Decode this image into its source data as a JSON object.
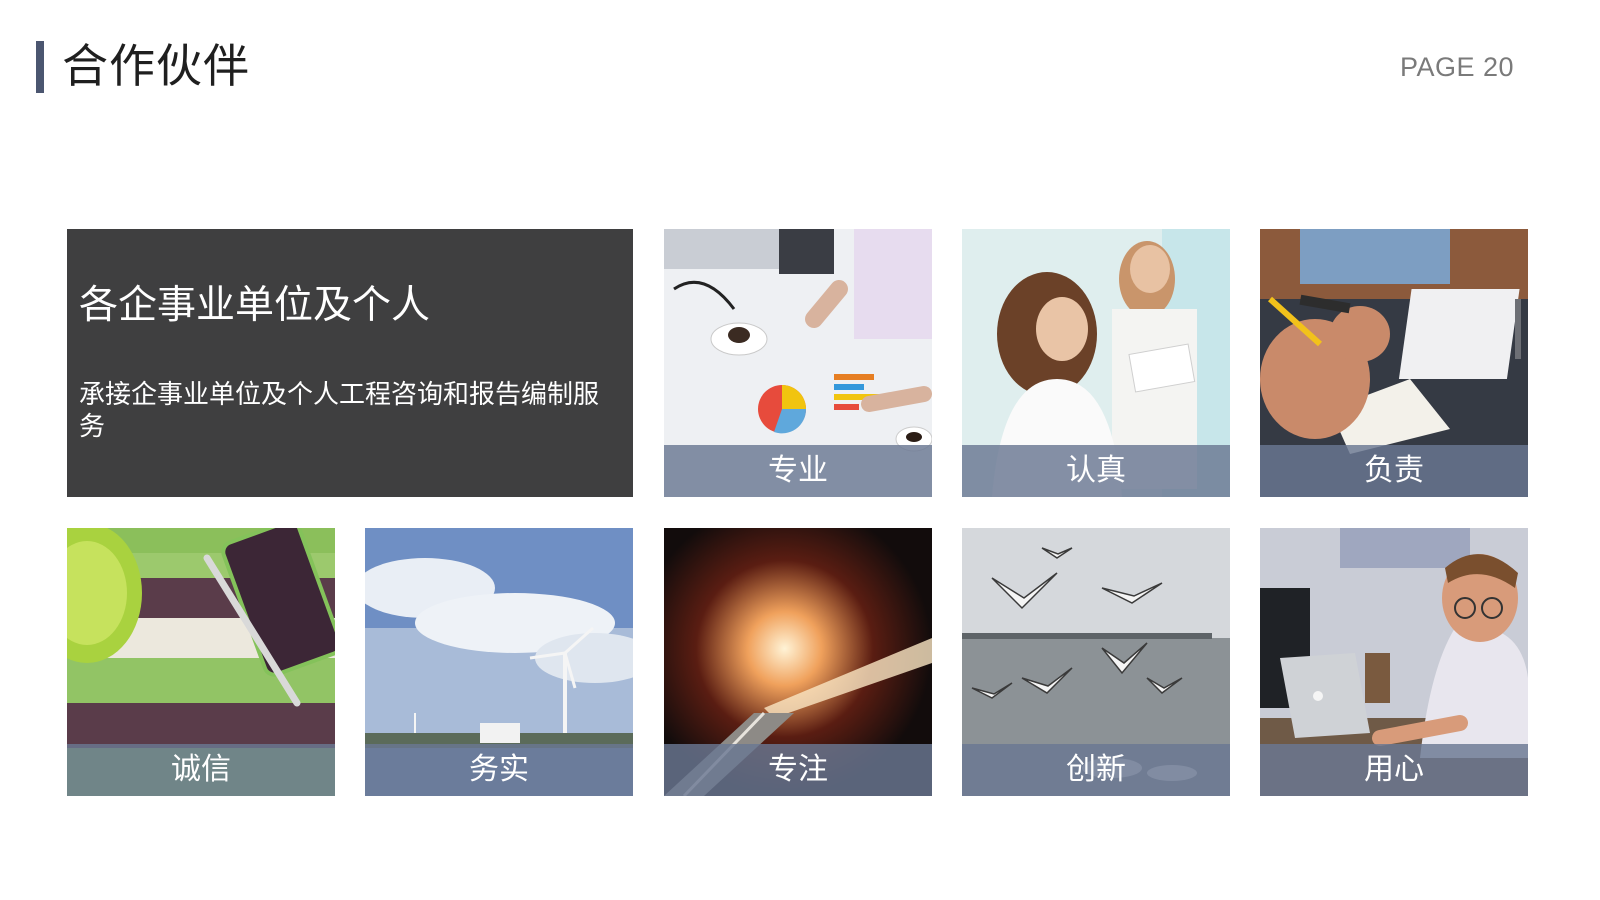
{
  "header": {
    "title": "合作伙伴",
    "page_label": "PAGE 20",
    "accent_color": "#4b5670"
  },
  "feature": {
    "title": "各企事业单位及个人",
    "description": "承接企事业单位及个人工程咨询和报告编制服务"
  },
  "tiles": [
    {
      "label": "专业",
      "image": "office-meeting-charts-photo"
    },
    {
      "label": "认真",
      "image": "two-women-reading-photo"
    },
    {
      "label": "负责",
      "image": "writing-notes-laptop-photo"
    },
    {
      "label": "诚信",
      "image": "pen-phone-striped-cloth-photo"
    },
    {
      "label": "务实",
      "image": "wind-turbines-sky-photo"
    },
    {
      "label": "专注",
      "image": "tunnel-light-trails-photo"
    },
    {
      "label": "创新",
      "image": "seagulls-over-water-photo"
    },
    {
      "label": "用心",
      "image": "man-at-laptop-photo"
    }
  ],
  "caption_color": "#6a7892"
}
